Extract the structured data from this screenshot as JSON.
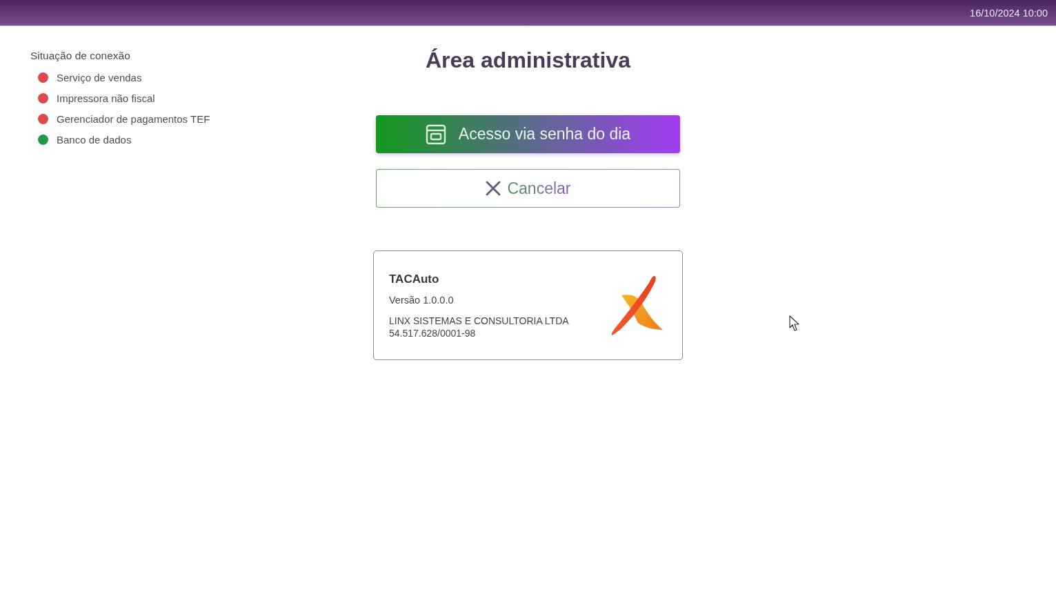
{
  "top_bar": {
    "datetime": "16/10/2024 10:00"
  },
  "connection_status": {
    "title": "Situação de conexão",
    "items": [
      {
        "label": "Serviço de vendas",
        "color": "#e04848"
      },
      {
        "label": "Impressora não fiscal",
        "color": "#e04848"
      },
      {
        "label": "Gerenciador de pagamentos TEF",
        "color": "#e04848"
      },
      {
        "label": "Banco de dados",
        "color": "#1e9a48"
      }
    ]
  },
  "title": "Área administrativa",
  "buttons": [
    {
      "kind": "primary",
      "label": "Acesso via senha do dia"
    },
    {
      "kind": "secondary",
      "label": "Cancelar"
    }
  ],
  "about": {
    "product": "TACAuto",
    "version": "Versão 1.0.0.0",
    "company": "LINX SISTEMAS E CONSULTORIA LTDA",
    "cnpj": "54.517.628/0001-98"
  }
}
